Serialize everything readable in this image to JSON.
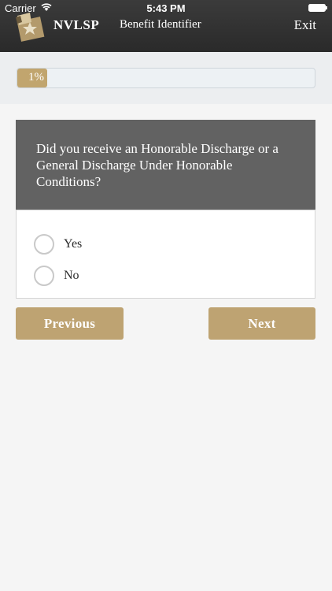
{
  "status_bar": {
    "carrier": "Carrier",
    "time": "5:43 PM"
  },
  "header": {
    "brand": "NVLSP",
    "title": "Benefit Identifier",
    "exit_label": "Exit"
  },
  "progress": {
    "value_percent": 1,
    "label": "1%"
  },
  "question": {
    "text": "Did you receive an Honorable Discharge or a General Discharge Under Honorable Conditions?",
    "options": [
      {
        "label": "Yes"
      },
      {
        "label": "No"
      }
    ]
  },
  "nav": {
    "previous_label": "Previous",
    "next_label": "Next"
  },
  "colors": {
    "header_bg": "#2f2f2f",
    "accent_gold": "#bea372",
    "question_bg": "#626262"
  }
}
